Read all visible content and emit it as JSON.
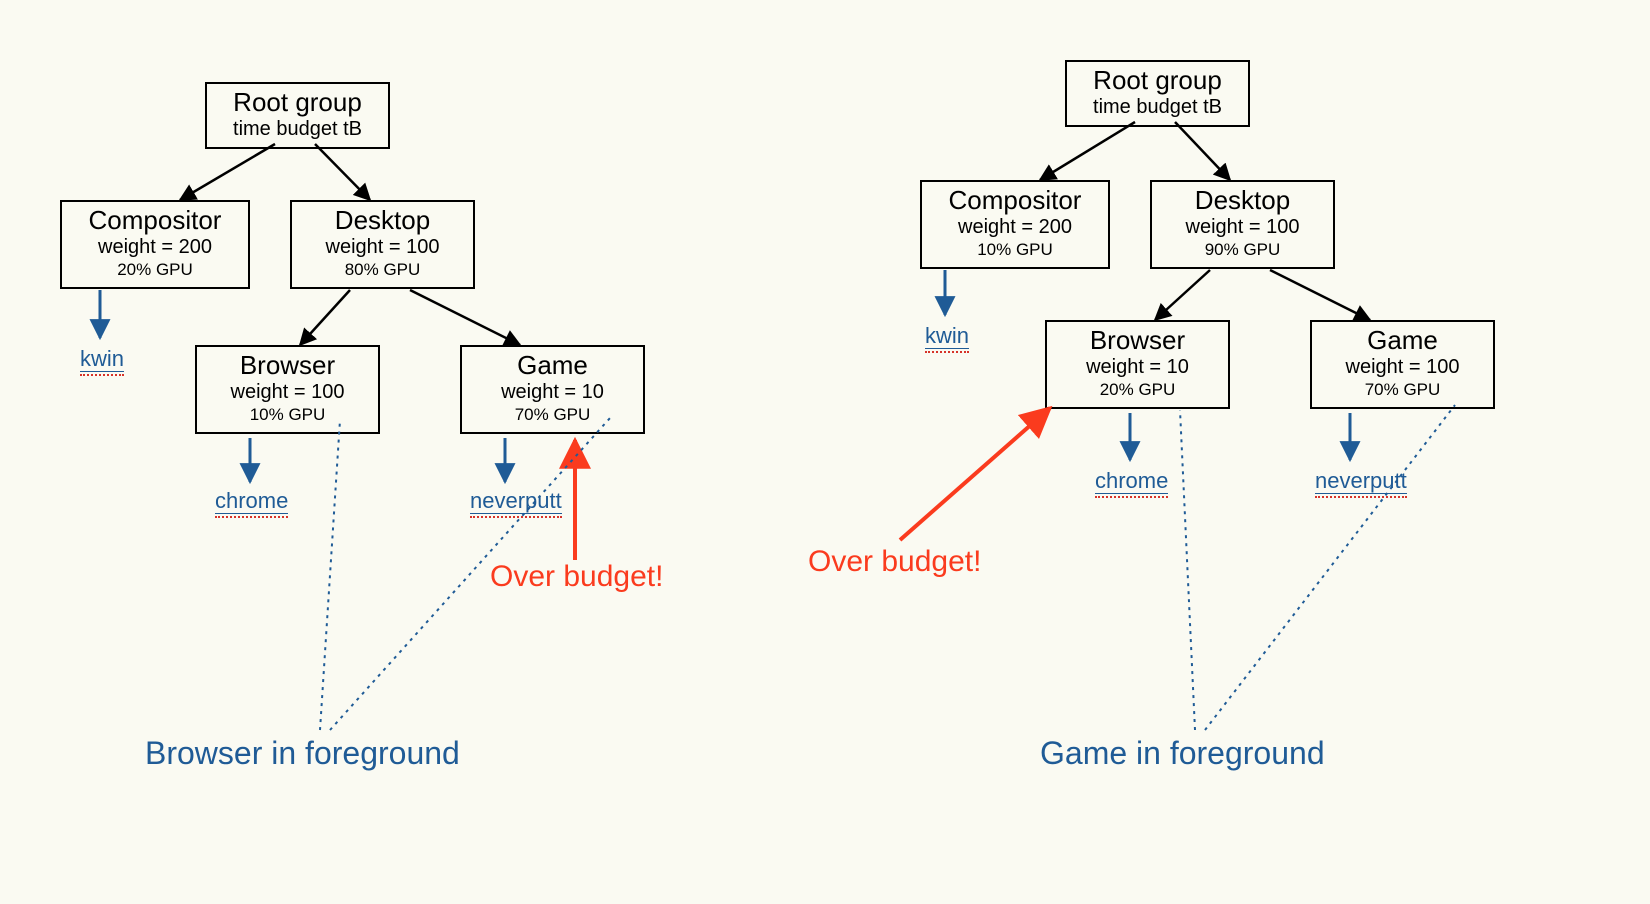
{
  "left": {
    "root": {
      "title": "Root group",
      "sub": "time budget tB"
    },
    "compositor": {
      "title": "Compositor",
      "sub": "weight = 200",
      "gpu": "20% GPU"
    },
    "desktop": {
      "title": "Desktop",
      "sub": "weight = 100",
      "gpu": "80% GPU"
    },
    "browser": {
      "title": "Browser",
      "sub": "weight = 100",
      "gpu": "10% GPU"
    },
    "game": {
      "title": "Game",
      "sub": "weight = 10",
      "gpu": "70% GPU"
    },
    "proc_kwin": "kwin",
    "proc_chrome": "chrome",
    "proc_neverputt": "neverputt",
    "caption": "Browser in foreground",
    "warn": "Over budget!"
  },
  "right": {
    "root": {
      "title": "Root group",
      "sub": "time budget tB"
    },
    "compositor": {
      "title": "Compositor",
      "sub": "weight = 200",
      "gpu": "10% GPU"
    },
    "desktop": {
      "title": "Desktop",
      "sub": "weight = 100",
      "gpu": "90% GPU"
    },
    "browser": {
      "title": "Browser",
      "sub": "weight = 10",
      "gpu": "20% GPU"
    },
    "game": {
      "title": "Game",
      "sub": "weight = 100",
      "gpu": "70% GPU"
    },
    "proc_kwin": "kwin",
    "proc_chrome": "chrome",
    "proc_neverputt": "neverputt",
    "caption": "Game in foreground",
    "warn": "Over budget!"
  }
}
